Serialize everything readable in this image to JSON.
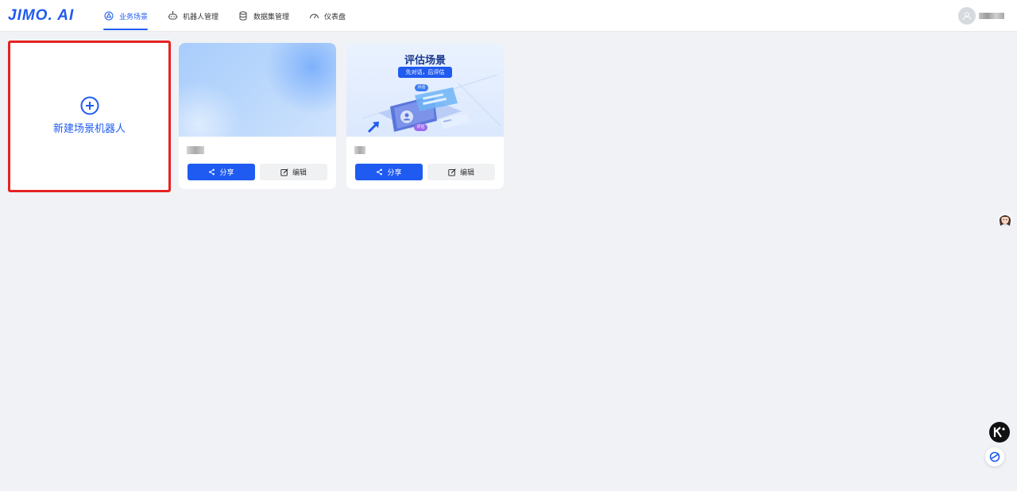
{
  "app": {
    "logo": "JIMO. AI"
  },
  "nav": {
    "items": [
      {
        "label": "业务场景",
        "icon": "scene-icon",
        "active": true
      },
      {
        "label": "机器人管理",
        "icon": "robot-icon",
        "active": false
      },
      {
        "label": "数据集管理",
        "icon": "database-icon",
        "active": false
      },
      {
        "label": "仪表盘",
        "icon": "dashboard-icon",
        "active": false
      }
    ]
  },
  "user": {
    "icon": "user-icon"
  },
  "new_card": {
    "label": "新建场景机器人",
    "icon": "plus-circle-icon"
  },
  "cards": [
    {
      "cover": "blue-gradient",
      "share_label": "分享",
      "edit_label": "编辑"
    },
    {
      "cover": "evaluation",
      "cover_title": "评估场景",
      "cover_subtitle": "先对话，后评估",
      "cover_tag1": "对话",
      "cover_tag2": "评估",
      "share_label": "分享",
      "edit_label": "编辑"
    }
  ],
  "colors": {
    "accent": "#1f5bf0",
    "highlight_frame": "#e52222",
    "background": "#f0f2f5"
  }
}
